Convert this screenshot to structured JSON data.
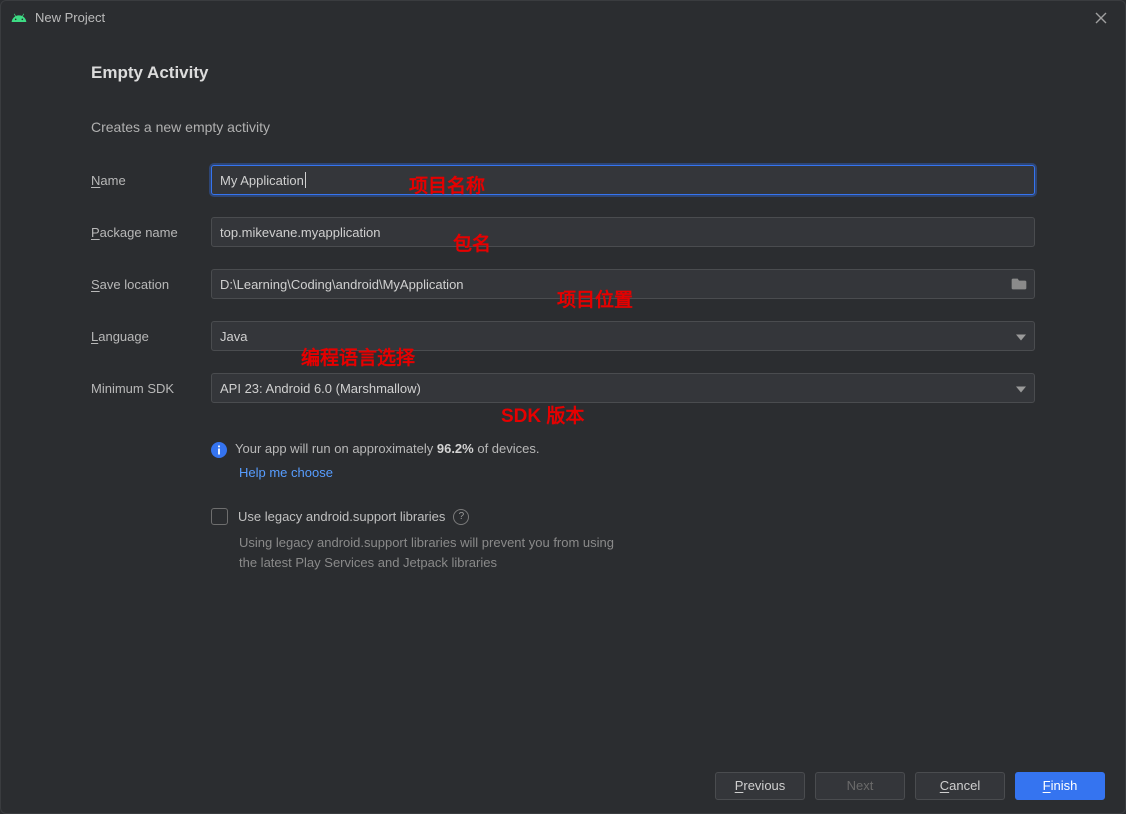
{
  "window": {
    "title": "New Project"
  },
  "page": {
    "heading": "Empty Activity",
    "subtitle": "Creates a new empty activity"
  },
  "labels": {
    "name_pre": "N",
    "name_suf": "ame",
    "pkg_pre": "P",
    "pkg_suf": "ackage name",
    "save_pre": "S",
    "save_suf": "ave location",
    "lang_pre": "L",
    "lang_suf": "anguage",
    "sdk": "Minimum SDK"
  },
  "fields": {
    "name": "My Application",
    "package": "top.mikevane.myapplication",
    "save_location": "D:\\Learning\\Coding\\android\\MyApplication",
    "language": "Java",
    "min_sdk": "API 23: Android 6.0 (Marshmallow)"
  },
  "info": {
    "text_pre": "Your app will run on approximately ",
    "percent": "96.2%",
    "text_post": " of devices.",
    "help_link": "Help me choose"
  },
  "legacy": {
    "label": "Use legacy android.support libraries",
    "desc_l1": "Using legacy android.support libraries will prevent you from using",
    "desc_l2": "the latest Play Services and Jetpack libraries"
  },
  "buttons": {
    "previous_pre": "P",
    "previous_suf": "revious",
    "next": "Next",
    "cancel_pre": "C",
    "cancel_suf": "ancel",
    "finish_pre": "F",
    "finish_suf": "inish"
  },
  "annotations": {
    "name": "项目名称",
    "pkg": "包名",
    "save": "项目位置",
    "lang": "编程语言选择",
    "sdk": "SDK 版本"
  }
}
